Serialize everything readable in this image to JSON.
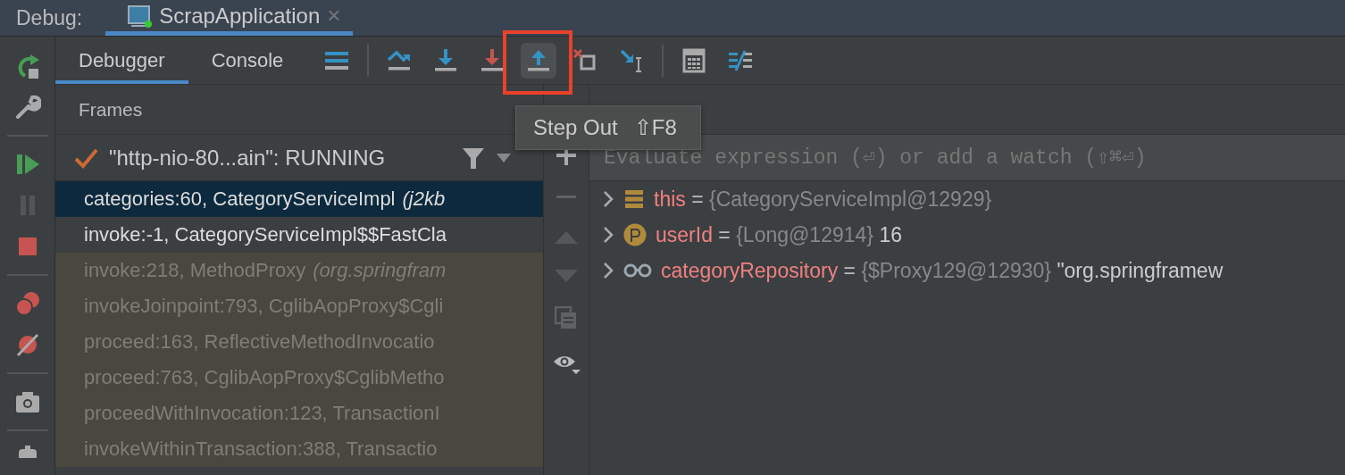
{
  "debug_label": "Debug:",
  "run_tab": {
    "title": "ScrapApplication",
    "close": "×",
    "selected": true
  },
  "tabs": [
    {
      "label": "Debugger",
      "selected": true
    },
    {
      "label": "Console",
      "selected": false
    }
  ],
  "toolbar": [
    {
      "kind": "layout",
      "hovered": false
    },
    {
      "kind": "step-over",
      "hovered": false
    },
    {
      "kind": "step-into",
      "hovered": false
    },
    {
      "kind": "force-step-into",
      "hovered": false
    },
    {
      "kind": "step-out",
      "hovered": true
    },
    {
      "kind": "drop-frame",
      "hovered": false
    },
    {
      "kind": "run-to-cursor",
      "hovered": false
    },
    {
      "kind": "evaluate",
      "hovered": false
    },
    {
      "kind": "trace",
      "hovered": false
    }
  ],
  "tooltip": {
    "title": "Step Out",
    "shortcut": "⇧F8"
  },
  "frames": {
    "header": "Frames",
    "thread": "\"http-nio-80...ain\": RUNNING",
    "rows": [
      {
        "kind": "app",
        "selected": true,
        "text": "categories:60, CategoryServiceImpl",
        "package": "(j2kb"
      },
      {
        "kind": "app",
        "selected": false,
        "text": "invoke:-1, CategoryServiceImpl$$FastCla"
      },
      {
        "kind": "library",
        "selected": false,
        "text": "invoke:218, MethodProxy",
        "package": "(org.springfram"
      },
      {
        "kind": "library",
        "selected": false,
        "text": "invokeJoinpoint:793, CglibAopProxy$Cgli"
      },
      {
        "kind": "library",
        "selected": false,
        "text": "proceed:163, ReflectiveMethodInvocatio"
      },
      {
        "kind": "library",
        "selected": false,
        "text": "proceed:763, CglibAopProxy$CglibMetho"
      },
      {
        "kind": "library",
        "selected": false,
        "text": "proceedWithInvocation:123, TransactionI"
      },
      {
        "kind": "library",
        "selected": false,
        "text": "invokeWithinTransaction:388, Transactio"
      }
    ]
  },
  "variables": {
    "placeholder": "Evaluate expression (⏎) or add a watch (⇧⌘⏎)",
    "rows": [
      {
        "kind": "object",
        "expanded": false,
        "name": "this",
        "separator": "=",
        "value": "{CategoryServiceImpl@12929}"
      },
      {
        "kind": "parameter",
        "expanded": false,
        "name": "userId",
        "separator": "=",
        "value": "{Long@12914}",
        "display": "16"
      },
      {
        "kind": "field",
        "expanded": false,
        "name": "categoryRepository",
        "separator": "=",
        "value": "{$Proxy129@12930}",
        "display": "\"org.springframew"
      }
    ]
  }
}
